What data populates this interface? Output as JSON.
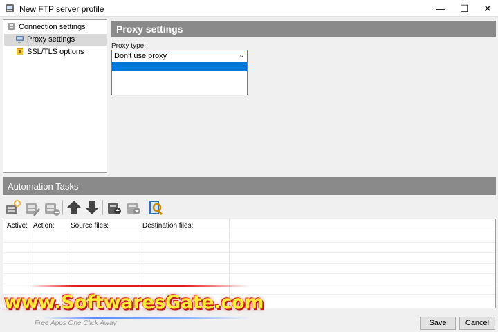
{
  "window": {
    "title": "New FTP server profile",
    "controls": {
      "minimize": "—",
      "maximize": "☐",
      "close": "✕"
    }
  },
  "tree": {
    "items": [
      {
        "label": "Connection settings",
        "icon": "connection-icon",
        "selected": false
      },
      {
        "label": "Proxy settings",
        "icon": "proxy-icon",
        "selected": true
      },
      {
        "label": "SSL/TLS options",
        "icon": "lock-icon",
        "selected": false
      }
    ]
  },
  "proxy": {
    "header": "Proxy settings",
    "type_label": "Proxy type:",
    "type_value": "Don't use proxy",
    "dropdown_open": true
  },
  "automation": {
    "header": "Automation Tasks",
    "toolbar_icons": [
      "add-task-icon",
      "edit-task-icon",
      "remove-task-icon",
      "move-up-icon",
      "move-down-icon",
      "import-icon",
      "export-icon",
      "search-icon"
    ],
    "columns": [
      "Active:",
      "Action:",
      "Source files:",
      "Destination files:"
    ],
    "rows": []
  },
  "buttons": {
    "save": "Save",
    "cancel": "Cancel"
  },
  "watermark": {
    "text": "www.SoftwaresGate.com",
    "tagline": "Free Apps One Click Away"
  },
  "colors": {
    "accent": "#0078d7",
    "header_bg": "#8a8a8a",
    "selected_bg": "#d9d9d9",
    "watermark_text": "#ffeb3b",
    "watermark_glow": "#c01b1b"
  }
}
